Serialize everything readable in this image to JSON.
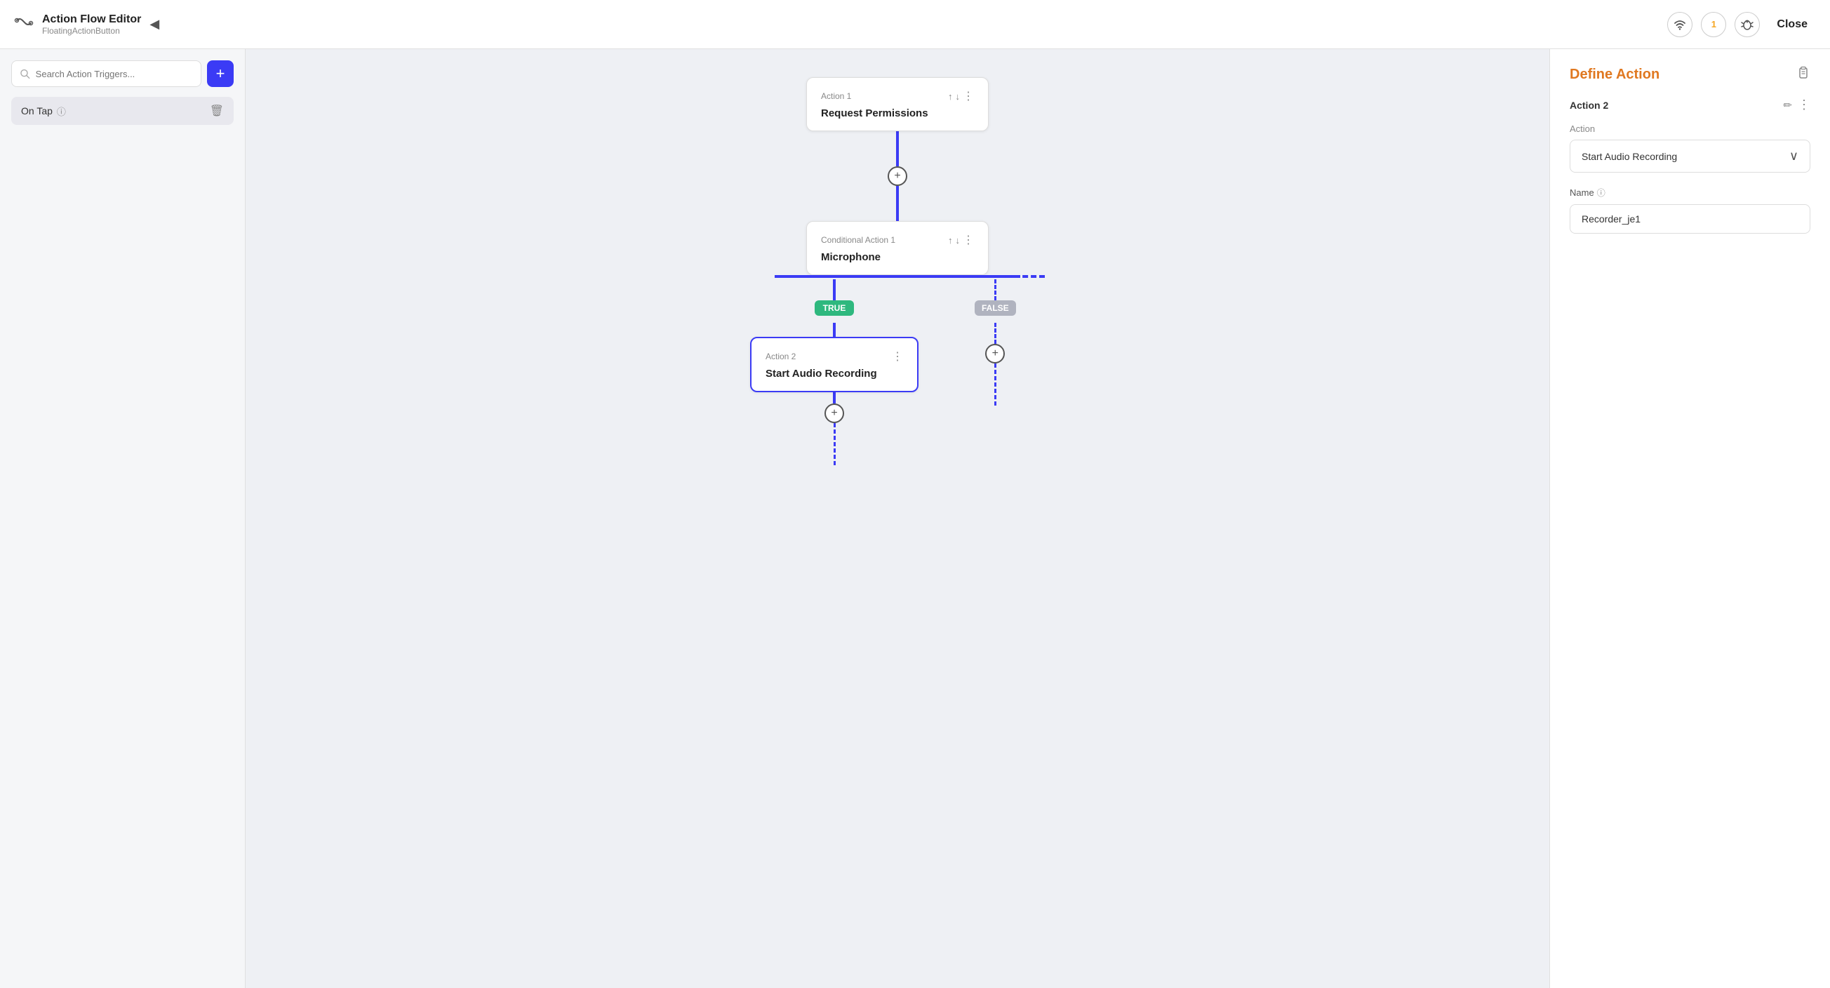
{
  "header": {
    "title": "Action Flow Editor",
    "subtitle": "FloatingActionButton",
    "collapse_label": "◀",
    "badge_count": "1",
    "close_label": "Close"
  },
  "sidebar": {
    "search_placeholder": "Search Action Triggers...",
    "add_btn_label": "+",
    "trigger": {
      "label": "On Tap",
      "info_icon": "ⓘ"
    }
  },
  "canvas": {
    "nodes": [
      {
        "id": "action1",
        "header_label": "Action 1",
        "title": "Request Permissions"
      },
      {
        "id": "conditional1",
        "header_label": "Conditional Action 1",
        "title": "Microphone"
      },
      {
        "id": "action2",
        "header_label": "Action 2",
        "title": "Start Audio Recording",
        "selected": true
      }
    ],
    "branch_true": "TRUE",
    "branch_false": "FALSE",
    "add_circle": "+",
    "add_circle_small": "+"
  },
  "right_panel": {
    "title": "Define Action",
    "action_label": "Action 2",
    "action_section": "Action",
    "action_type": "Start Audio Recording",
    "name_label": "Name",
    "name_info": "ⓘ",
    "name_value": "Recorder_je1",
    "dropdown_arrow": "∨",
    "edit_icon": "✏",
    "menu_icon": "⋮",
    "clipboard_icon": "📋"
  }
}
